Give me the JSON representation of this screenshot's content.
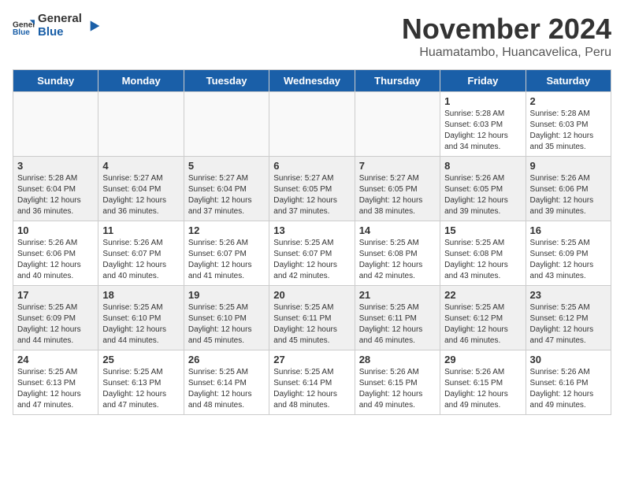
{
  "logo": {
    "general": "General",
    "blue": "Blue"
  },
  "calendar": {
    "title": "November 2024",
    "subtitle": "Huamatambo, Huancavelica, Peru"
  },
  "headers": [
    "Sunday",
    "Monday",
    "Tuesday",
    "Wednesday",
    "Thursday",
    "Friday",
    "Saturday"
  ],
  "weeks": [
    [
      {
        "day": "",
        "empty": true
      },
      {
        "day": "",
        "empty": true
      },
      {
        "day": "",
        "empty": true
      },
      {
        "day": "",
        "empty": true
      },
      {
        "day": "",
        "empty": true
      },
      {
        "day": "1",
        "sunrise": "5:28 AM",
        "sunset": "6:03 PM",
        "daylight": "12 hours and 34 minutes."
      },
      {
        "day": "2",
        "sunrise": "5:28 AM",
        "sunset": "6:03 PM",
        "daylight": "12 hours and 35 minutes."
      }
    ],
    [
      {
        "day": "3",
        "sunrise": "5:28 AM",
        "sunset": "6:04 PM",
        "daylight": "12 hours and 36 minutes."
      },
      {
        "day": "4",
        "sunrise": "5:27 AM",
        "sunset": "6:04 PM",
        "daylight": "12 hours and 36 minutes."
      },
      {
        "day": "5",
        "sunrise": "5:27 AM",
        "sunset": "6:04 PM",
        "daylight": "12 hours and 37 minutes."
      },
      {
        "day": "6",
        "sunrise": "5:27 AM",
        "sunset": "6:05 PM",
        "daylight": "12 hours and 37 minutes."
      },
      {
        "day": "7",
        "sunrise": "5:27 AM",
        "sunset": "6:05 PM",
        "daylight": "12 hours and 38 minutes."
      },
      {
        "day": "8",
        "sunrise": "5:26 AM",
        "sunset": "6:05 PM",
        "daylight": "12 hours and 39 minutes."
      },
      {
        "day": "9",
        "sunrise": "5:26 AM",
        "sunset": "6:06 PM",
        "daylight": "12 hours and 39 minutes."
      }
    ],
    [
      {
        "day": "10",
        "sunrise": "5:26 AM",
        "sunset": "6:06 PM",
        "daylight": "12 hours and 40 minutes."
      },
      {
        "day": "11",
        "sunrise": "5:26 AM",
        "sunset": "6:07 PM",
        "daylight": "12 hours and 40 minutes."
      },
      {
        "day": "12",
        "sunrise": "5:26 AM",
        "sunset": "6:07 PM",
        "daylight": "12 hours and 41 minutes."
      },
      {
        "day": "13",
        "sunrise": "5:25 AM",
        "sunset": "6:07 PM",
        "daylight": "12 hours and 42 minutes."
      },
      {
        "day": "14",
        "sunrise": "5:25 AM",
        "sunset": "6:08 PM",
        "daylight": "12 hours and 42 minutes."
      },
      {
        "day": "15",
        "sunrise": "5:25 AM",
        "sunset": "6:08 PM",
        "daylight": "12 hours and 43 minutes."
      },
      {
        "day": "16",
        "sunrise": "5:25 AM",
        "sunset": "6:09 PM",
        "daylight": "12 hours and 43 minutes."
      }
    ],
    [
      {
        "day": "17",
        "sunrise": "5:25 AM",
        "sunset": "6:09 PM",
        "daylight": "12 hours and 44 minutes."
      },
      {
        "day": "18",
        "sunrise": "5:25 AM",
        "sunset": "6:10 PM",
        "daylight": "12 hours and 44 minutes."
      },
      {
        "day": "19",
        "sunrise": "5:25 AM",
        "sunset": "6:10 PM",
        "daylight": "12 hours and 45 minutes."
      },
      {
        "day": "20",
        "sunrise": "5:25 AM",
        "sunset": "6:11 PM",
        "daylight": "12 hours and 45 minutes."
      },
      {
        "day": "21",
        "sunrise": "5:25 AM",
        "sunset": "6:11 PM",
        "daylight": "12 hours and 46 minutes."
      },
      {
        "day": "22",
        "sunrise": "5:25 AM",
        "sunset": "6:12 PM",
        "daylight": "12 hours and 46 minutes."
      },
      {
        "day": "23",
        "sunrise": "5:25 AM",
        "sunset": "6:12 PM",
        "daylight": "12 hours and 47 minutes."
      }
    ],
    [
      {
        "day": "24",
        "sunrise": "5:25 AM",
        "sunset": "6:13 PM",
        "daylight": "12 hours and 47 minutes."
      },
      {
        "day": "25",
        "sunrise": "5:25 AM",
        "sunset": "6:13 PM",
        "daylight": "12 hours and 47 minutes."
      },
      {
        "day": "26",
        "sunrise": "5:25 AM",
        "sunset": "6:14 PM",
        "daylight": "12 hours and 48 minutes."
      },
      {
        "day": "27",
        "sunrise": "5:25 AM",
        "sunset": "6:14 PM",
        "daylight": "12 hours and 48 minutes."
      },
      {
        "day": "28",
        "sunrise": "5:26 AM",
        "sunset": "6:15 PM",
        "daylight": "12 hours and 49 minutes."
      },
      {
        "day": "29",
        "sunrise": "5:26 AM",
        "sunset": "6:15 PM",
        "daylight": "12 hours and 49 minutes."
      },
      {
        "day": "30",
        "sunrise": "5:26 AM",
        "sunset": "6:16 PM",
        "daylight": "12 hours and 49 minutes."
      }
    ]
  ]
}
